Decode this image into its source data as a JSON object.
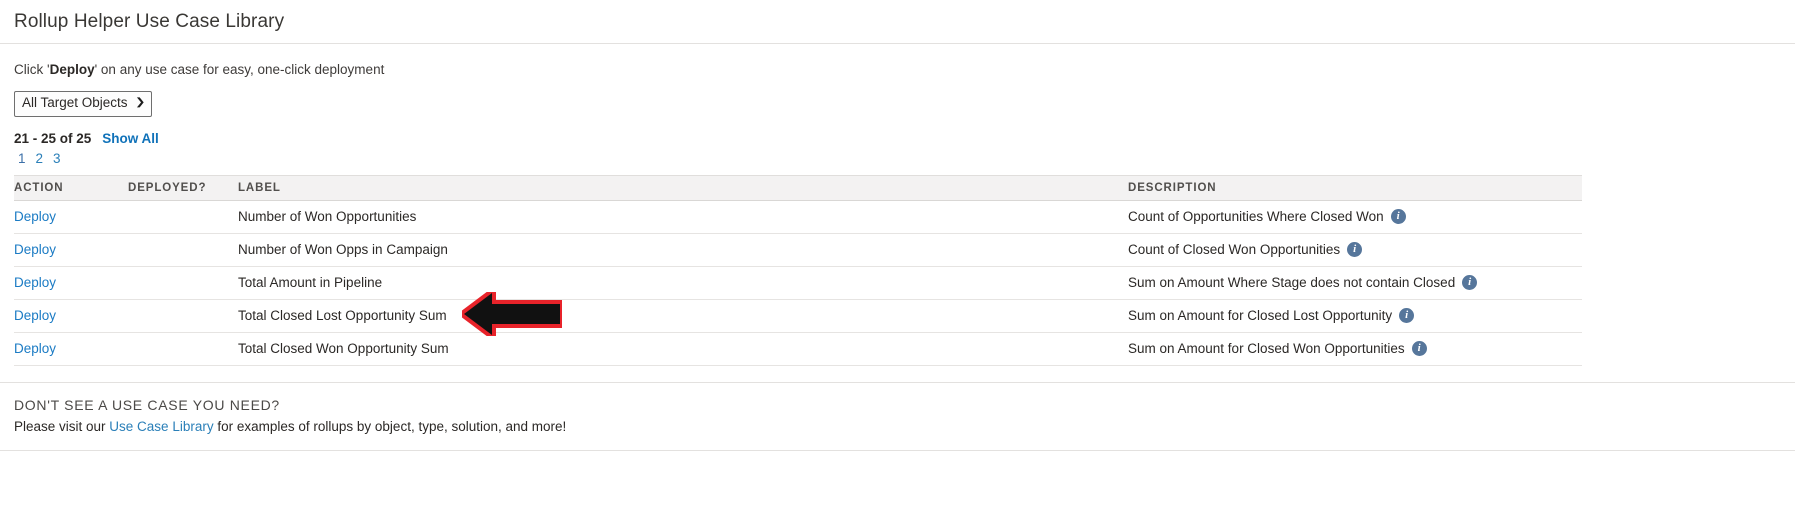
{
  "header": {
    "title": "Rollup Helper Use Case Library"
  },
  "intro": {
    "prefix": "Click '",
    "emphasis": "Deploy",
    "suffix": "' on any use case for easy, one-click deployment"
  },
  "filter": {
    "selected": "All Target Objects",
    "caret_icon": "chevron-down-icon",
    "options": [
      "All Target Objects"
    ]
  },
  "pagination": {
    "range_label": "21 - 25 of 25",
    "show_all_label": "Show All",
    "pages": [
      "1",
      "2",
      "3"
    ],
    "current_page": "1"
  },
  "table": {
    "columns": [
      "ACTION",
      "DEPLOYED?",
      "LABEL",
      "DESCRIPTION"
    ],
    "rows": [
      {
        "action": "Deploy",
        "deployed": "",
        "label": "Number of Won Opportunities",
        "description": "Count of Opportunities Where Closed Won",
        "info_icon": "info-icon"
      },
      {
        "action": "Deploy",
        "deployed": "",
        "label": "Number of Won Opps in Campaign",
        "description": "Count of Closed Won Opportunities",
        "info_icon": "info-icon"
      },
      {
        "action": "Deploy",
        "deployed": "",
        "label": "Total Amount in Pipeline",
        "description": "Sum on Amount Where Stage does not contain Closed",
        "info_icon": "info-icon"
      },
      {
        "action": "Deploy",
        "deployed": "",
        "label": "Total Closed Lost Opportunity Sum",
        "description": "Sum on Amount for Closed Lost Opportunity",
        "info_icon": "info-icon"
      },
      {
        "action": "Deploy",
        "deployed": "",
        "label": "Total Closed Won Opportunity Sum",
        "description": "Sum on Amount for Closed Won Opportunities",
        "info_icon": "info-icon"
      }
    ]
  },
  "footer": {
    "heading": "DON'T SEE A USE CASE YOU NEED?",
    "line_prefix": "Please visit our ",
    "link_label": "Use Case Library",
    "line_suffix": " for examples of rollups by object, type, solution, and more!"
  },
  "annotation": {
    "arrow_icon": "left-arrow-annotation",
    "fill_color": "#111111",
    "outline_color": "#e8232a",
    "points_at_row": "Total Closed Lost Opportunity Sum"
  },
  "colors": {
    "link": "#1b7bc4",
    "header_bg": "#f3f2f2",
    "info_badge": "#56769b"
  }
}
